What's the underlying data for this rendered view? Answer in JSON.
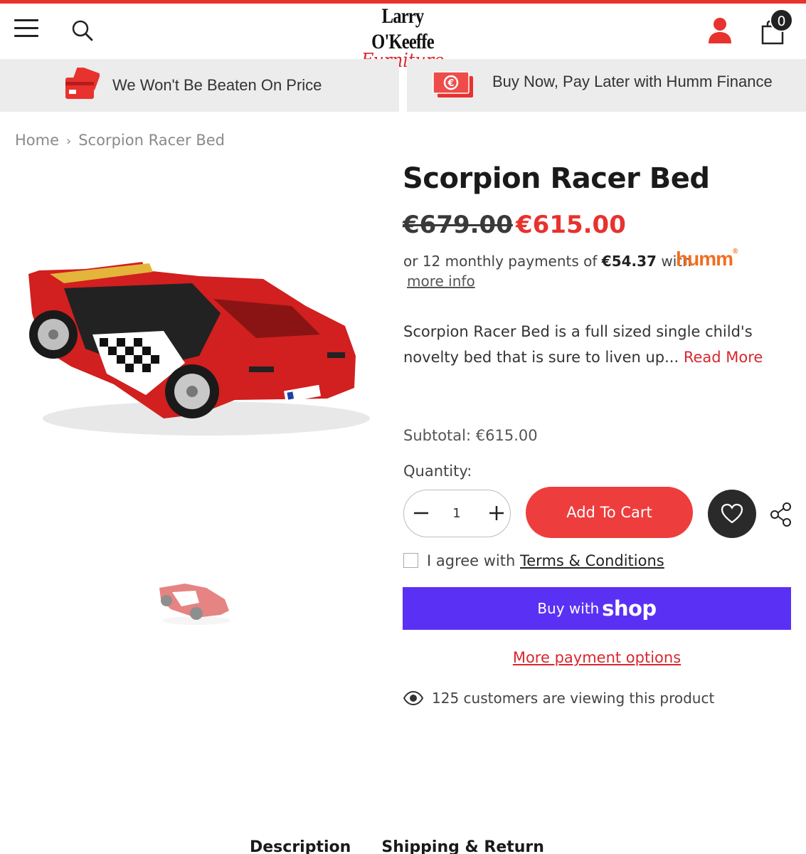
{
  "header": {
    "logo_top": "Larry O'Keeffe",
    "logo_bottom": "Furniture",
    "cart_count": "0"
  },
  "promos": [
    {
      "label": "We Won't Be Beaten On Price",
      "icon": "credit-card-icon"
    },
    {
      "label": "Buy Now, Pay Later with Humm Finance",
      "icon": "cash-icon"
    }
  ],
  "breadcrumb": {
    "home": "Home",
    "separator": "›",
    "current": "Scorpion Racer Bed"
  },
  "product": {
    "title": "Scorpion Racer Bed",
    "price_old": "€679.00",
    "price_new": "€615.00",
    "humm_prefix": "or 12 monthly payments of",
    "humm_amount": "€54.37",
    "humm_suffix": "with",
    "humm_logo": "humm",
    "more_info": "more info",
    "description": "Scorpion Racer Bed is a full sized single child's novelty bed that is sure to liven up...",
    "read_more": "Read More",
    "subtotal_label": "Subtotal:",
    "subtotal_value": "€615.00",
    "quantity_label": "Quantity:",
    "quantity_value": "1",
    "add_to_cart": "Add To Cart",
    "terms_prefix": "I agree with",
    "terms_link": "Terms & Conditions",
    "buy_with": "Buy with",
    "shop": "shop",
    "more_payment": "More payment options",
    "viewers": "125 customers are viewing this product"
  },
  "tabs": [
    "Description",
    "Shipping & Return"
  ],
  "colors": {
    "accent": "#e8322e",
    "shop_pay": "#5a31f4",
    "humm": "#f26d21"
  }
}
